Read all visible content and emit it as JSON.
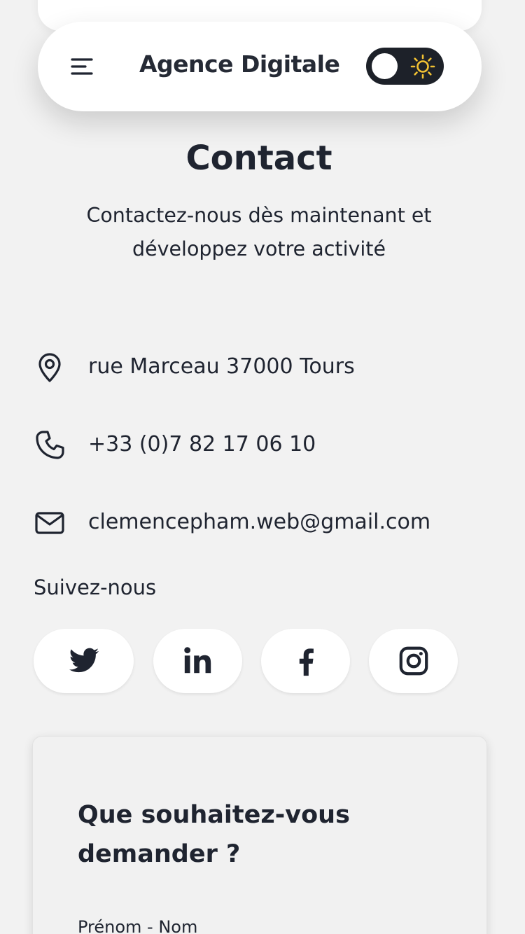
{
  "header": {
    "brand": "Agence Digitale",
    "theme_toggle": {
      "state": "light"
    }
  },
  "contact": {
    "title": "Contact",
    "subtitle": "Contactez-nous dès maintenant et développez votre activité",
    "items": [
      {
        "icon": "map-pin-icon",
        "text": "rue Marceau 37000 Tours"
      },
      {
        "icon": "phone-icon",
        "text": "+33 (0)7 82 17 06 10"
      },
      {
        "icon": "mail-icon",
        "text": "clemencepham.web@gmail.com"
      }
    ]
  },
  "social": {
    "label": "Suivez-nous",
    "links": [
      {
        "icon": "twitter-icon"
      },
      {
        "icon": "linkedin-icon"
      },
      {
        "icon": "facebook-icon"
      },
      {
        "icon": "instagram-icon"
      }
    ]
  },
  "form": {
    "heading": "Que souhaitez-vous demander ?",
    "fields": [
      {
        "label": "Prénom - Nom"
      }
    ]
  },
  "colors": {
    "background": "#f2f2f2",
    "card": "#ffffff",
    "text": "#1f2430",
    "toggle_track": "#1d2129",
    "sun": "#f2c233"
  }
}
